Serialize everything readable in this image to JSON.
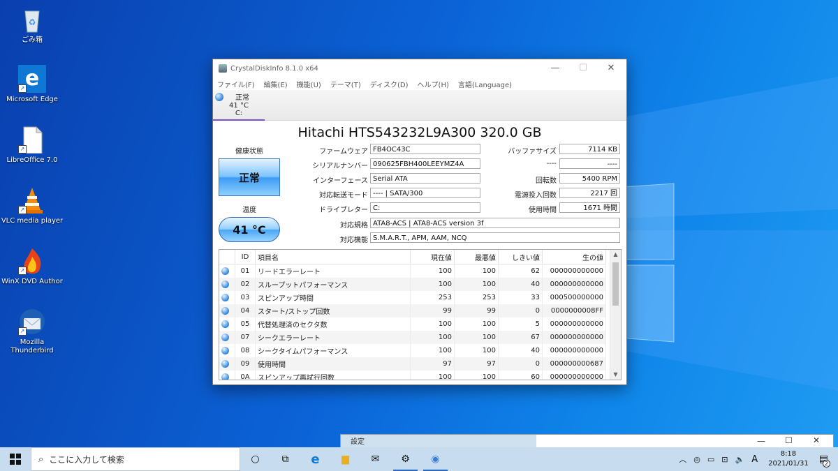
{
  "desktop": {
    "icons": [
      {
        "label": "ごみ箱",
        "icon": "recycle-bin"
      },
      {
        "label": "Microsoft Edge",
        "icon": "edge"
      },
      {
        "label": "LibreOffice 7.0",
        "icon": "libreoffice"
      },
      {
        "label": "VLC media player",
        "icon": "vlc"
      },
      {
        "label": "WinX DVD Author",
        "icon": "winx-dvd"
      },
      {
        "label": "Mozilla Thunderbird",
        "icon": "thunderbird"
      }
    ]
  },
  "window": {
    "title": "CrystalDiskInfo 8.1.0 x64",
    "menu": [
      "ファイル(F)",
      "編集(E)",
      "機能(U)",
      "テーマ(T)",
      "ディスク(D)",
      "ヘルプ(H)",
      "言語(Language)"
    ],
    "disk_tab": {
      "status": "正常",
      "temp": "41 °C",
      "drive": "C:"
    },
    "model": "Hitachi HTS543232L9A300 320.0 GB",
    "health_label": "健康状態",
    "health_value": "正常",
    "temp_label": "温度",
    "temp_value": "41 °C",
    "fields_left": [
      {
        "label": "ファームウェア",
        "value": "FB4OC43C"
      },
      {
        "label": "シリアルナンバー",
        "value": "090625FBH400LEEYMZ4A"
      },
      {
        "label": "インターフェース",
        "value": "Serial ATA"
      },
      {
        "label": "対応転送モード",
        "value": "---- | SATA/300"
      },
      {
        "label": "ドライブレター",
        "value": "C:"
      }
    ],
    "fields_right": [
      {
        "label": "バッファサイズ",
        "value": "7114 KB"
      },
      {
        "label": "----",
        "value": "----"
      },
      {
        "label": "回転数",
        "value": "5400 RPM"
      },
      {
        "label": "電源投入回数",
        "value": "2217 回"
      },
      {
        "label": "使用時間",
        "value": "1671 時間"
      }
    ],
    "standard": {
      "label": "対応規格",
      "value": "ATA8-ACS | ATA8-ACS version 3f"
    },
    "features": {
      "label": "対応機能",
      "value": "S.M.A.R.T., APM, AAM, NCQ"
    },
    "smart_headers": [
      "ID",
      "項目名",
      "現在値",
      "最悪値",
      "しきい値",
      "生の値"
    ],
    "smart_rows": [
      [
        "01",
        "リードエラーレート",
        "100",
        "100",
        "62",
        "000000000000"
      ],
      [
        "02",
        "スループットパフォーマンス",
        "100",
        "100",
        "40",
        "000000000000"
      ],
      [
        "03",
        "スピンアップ時間",
        "253",
        "253",
        "33",
        "000500000000"
      ],
      [
        "04",
        "スタート/ストップ回数",
        "99",
        "99",
        "0",
        "0000000008FF"
      ],
      [
        "05",
        "代替処理済のセクタ数",
        "100",
        "100",
        "5",
        "000000000000"
      ],
      [
        "07",
        "シークエラーレート",
        "100",
        "100",
        "67",
        "000000000000"
      ],
      [
        "08",
        "シークタイムパフォーマンス",
        "100",
        "100",
        "40",
        "000000000000"
      ],
      [
        "09",
        "使用時間",
        "97",
        "97",
        "0",
        "000000000687"
      ],
      [
        "0A",
        "スピンアップ再試行回数",
        "100",
        "100",
        "60",
        "000000000000"
      ]
    ]
  },
  "second_window": {
    "title": "設定"
  },
  "taskbar": {
    "search_placeholder": "ここに入力して検索",
    "ime": "A",
    "time": "8:18",
    "date": "2021/01/31",
    "notification_count": "2"
  }
}
